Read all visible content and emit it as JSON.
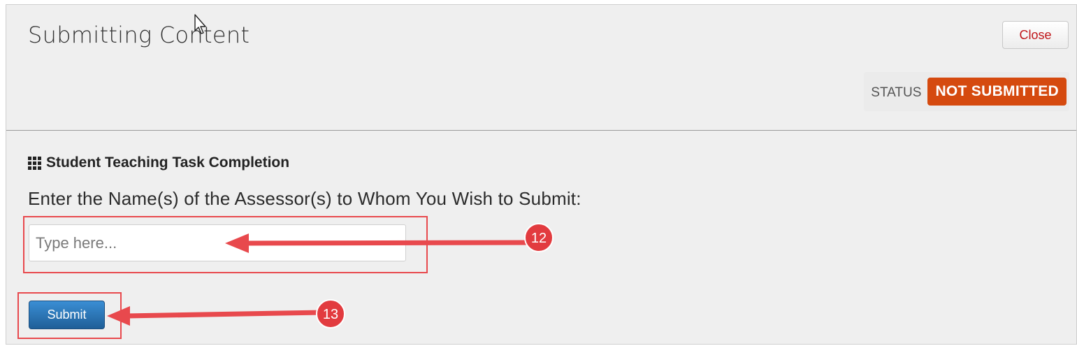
{
  "header": {
    "title": "Submitting Content",
    "close_label": "Close",
    "status_label": "STATUS",
    "status_value": "NOT SUBMITTED",
    "status_color": "#d54a0f"
  },
  "main": {
    "section_icon": "grid-icon",
    "section_title": "Student Teaching Task Completion",
    "prompt": "Enter the Name(s) of the Assessor(s) to Whom You Wish to Submit:",
    "assessor_input": {
      "value": "",
      "placeholder": "Type here..."
    },
    "submit_label": "Submit"
  },
  "annotations": {
    "callout_input": "12",
    "callout_submit": "13",
    "highlight_color": "#e8494d"
  }
}
